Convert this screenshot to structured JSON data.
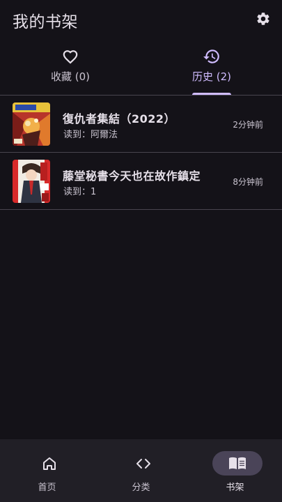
{
  "header": {
    "title": "我的书架"
  },
  "tabs": [
    {
      "label": "收藏 (0)",
      "icon": "heart-outline-icon"
    },
    {
      "label": "历史 (2)",
      "icon": "history-icon",
      "selected": true
    }
  ],
  "history": [
    {
      "title": "復仇者集結（2022）",
      "subtitle": "读到：阿爾法",
      "time": "2分钟前"
    },
    {
      "title": "藤堂秘書今天也在故作鎮定",
      "subtitle": "读到：1",
      "time": "8分钟前"
    }
  ],
  "bottom_nav": [
    {
      "label": "首页",
      "icon": "home-icon"
    },
    {
      "label": "分类",
      "icon": "code-brackets-icon"
    },
    {
      "label": "书架",
      "icon": "book-open-icon",
      "selected": true
    }
  ],
  "colors": {
    "background": "#141218",
    "accent": "#d0bcff",
    "nav_background": "#211f26",
    "nav_active_pill": "#4a4458"
  }
}
